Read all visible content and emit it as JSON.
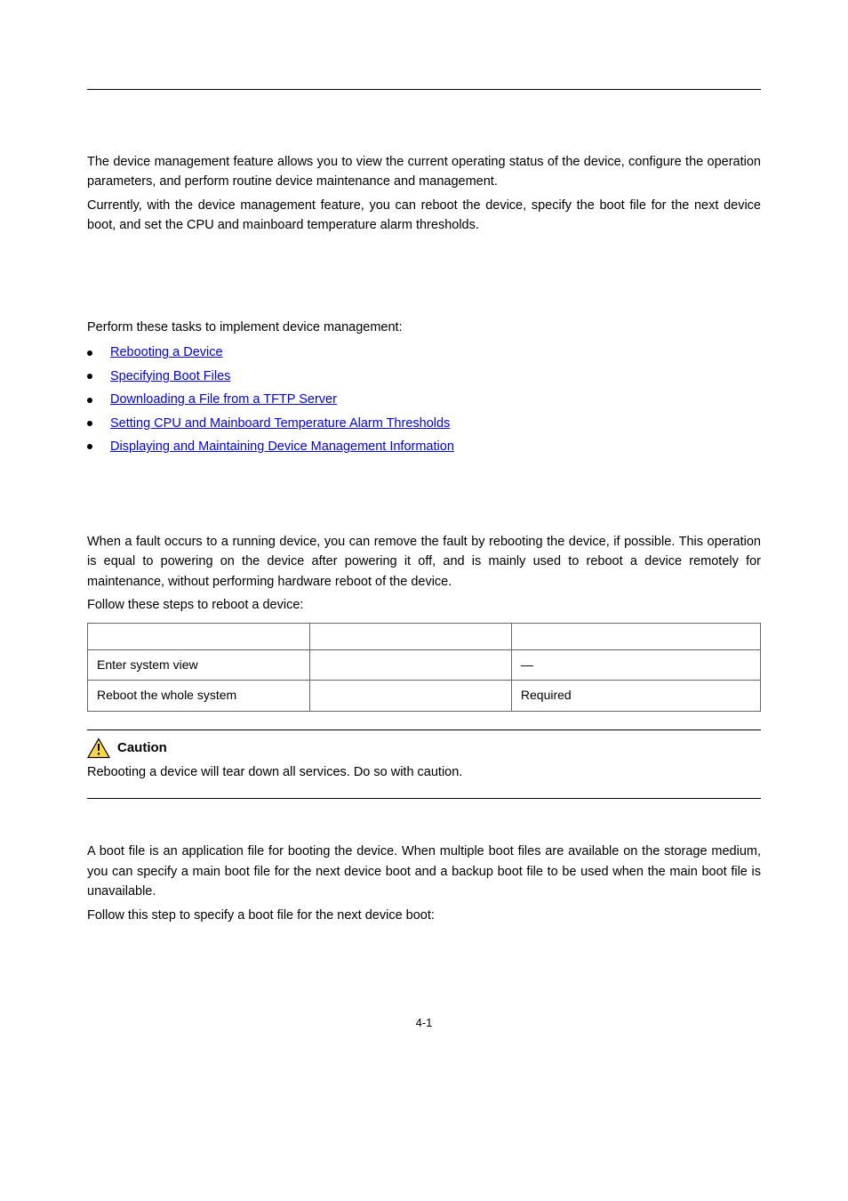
{
  "intro": {
    "p1": "The device management feature allows you to view the current operating status of the device, configure the operation parameters, and perform routine device maintenance and management.",
    "p2": "Currently, with the device management feature, you can reboot the device, specify the boot file for the next device boot, and set the CPU and mainboard temperature alarm thresholds."
  },
  "tasks_lead": "Perform these tasks to implement device management:",
  "links": {
    "l1": "Rebooting a Device",
    "l2": "Specifying Boot Files",
    "l3": "Downloading a File from a TFTP Server",
    "l4": "Setting CPU and Mainboard Temperature Alarm Thresholds",
    "l5": "Displaying and Maintaining Device Management Information"
  },
  "reboot": {
    "p1": "When a fault occurs to a running device, you can remove the fault by rebooting the device, if possible. This operation is equal to powering on the device after powering it off, and is mainly used to reboot a device remotely for maintenance, without performing hardware reboot of the device.",
    "p2": "Follow these steps to reboot a device:"
  },
  "table": {
    "r1c1": "Enter system view",
    "r1c3": "—",
    "r2c1": "Reboot the whole system",
    "r2c3": "Required"
  },
  "caution": {
    "label": "Caution",
    "text": "Rebooting a device will tear down all services. Do so with caution.",
    "icon_name": "warning-triangle-icon"
  },
  "boot": {
    "p1": "A boot file is an application file for booting the device. When multiple boot files are available on the storage medium, you can specify a main boot file for the next device boot and a backup boot file to be used when the main boot file is unavailable.",
    "p2": "Follow this step to specify a boot file for the next device boot:"
  },
  "page_number": "4-1"
}
